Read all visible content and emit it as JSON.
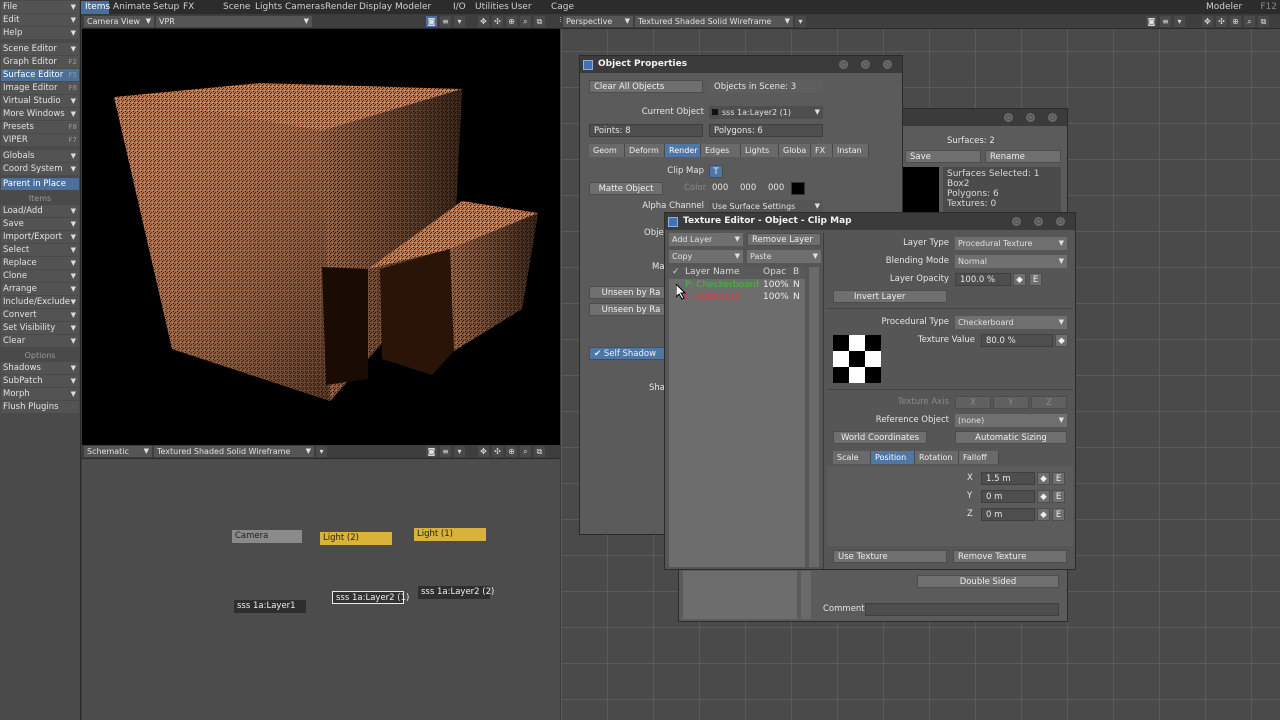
{
  "menu_tabs": [
    "Items",
    "Animate",
    "Setup",
    "FX Tools",
    "Scene",
    "Lights",
    "Cameras",
    "Render",
    "Display",
    "Modeler Tools",
    "I/O",
    "Utilities",
    "User Tab",
    "Cage Deformer"
  ],
  "modeler_label": "Modeler",
  "modeler_key": "F12",
  "left_menu": {
    "top": [
      {
        "label": "File"
      },
      {
        "label": "Edit"
      },
      {
        "label": "Help"
      }
    ],
    "editors": [
      {
        "label": "Scene Editor",
        "key": ""
      },
      {
        "label": "Graph Editor",
        "key": "F2"
      },
      {
        "label": "Surface Editor",
        "key": "F5"
      },
      {
        "label": "Image Editor",
        "key": "F6"
      },
      {
        "label": "Virtual Studio",
        "key": ""
      },
      {
        "label": "More Windows",
        "key": ""
      },
      {
        "label": "Presets",
        "key": "F8"
      },
      {
        "label": "VIPER",
        "key": "F7"
      }
    ],
    "globals": [
      {
        "label": "Globals"
      },
      {
        "label": "Coord System"
      }
    ],
    "parent_in_place": "Parent in Place",
    "items_header": "Items",
    "items": [
      {
        "label": "Load/Add"
      },
      {
        "label": "Save"
      },
      {
        "label": "Import/Export"
      },
      {
        "label": "Select"
      },
      {
        "label": "Replace"
      },
      {
        "label": "Clone"
      },
      {
        "label": "Arrange"
      },
      {
        "label": "Include/Exclude"
      },
      {
        "label": "Convert"
      },
      {
        "label": "Set Visibility"
      },
      {
        "label": "Clear"
      }
    ],
    "options_header": "Options",
    "options": [
      {
        "label": "Shadows"
      },
      {
        "label": "SubPatch"
      },
      {
        "label": "Morph"
      },
      {
        "label": "Flush Plugins"
      }
    ]
  },
  "vp_camera": {
    "view": "Camera View",
    "mode": "VPR"
  },
  "vp_schematic": {
    "view": "Schematic",
    "mode": "Textured Shaded Solid Wireframe"
  },
  "schematic_nodes": [
    "Camera",
    "Light (2)",
    "Light (1)",
    "sss 1a:Layer1",
    "sss 1a:Layer2 (1)",
    "sss 1a:Layer2 (2)"
  ],
  "vp_perspective": {
    "view": "Perspective",
    "mode": "Textured Shaded Solid Wireframe"
  },
  "object_properties": {
    "title": "Object Properties",
    "clear_all": "Clear All Objects",
    "objects_in_scene": "Objects in Scene: 3",
    "current_object_label": "Current Object",
    "current_object": "sss 1a:Layer2 (1)",
    "points": "Points: 8",
    "polygons": "Polygons: 6",
    "tabs": [
      "Geom",
      "Deform",
      "Render",
      "Edges",
      "Lights",
      "Globa",
      "FX",
      "Instan"
    ],
    "active_tab": "Render",
    "clip_map_label": "Clip Map",
    "clip_map_btn": "T",
    "matte_object": "Matte Object",
    "color_label": "Color",
    "color_vals": [
      "000",
      "000",
      "000"
    ],
    "alpha_label": "Alpha Channel",
    "alpha_value": "Use Surface Settings",
    "obj_partial": "Objec",
    "ma_partial": "Ma",
    "unseen1": "Unseen by Ra",
    "unseen2": "Unseen by Ra",
    "self_shadow": "Self Shadow",
    "sha_partial": "Shad"
  },
  "surface_editor": {
    "surfaces": "Surfaces: 2",
    "save": "Save",
    "rename": "Rename",
    "info": [
      "Surfaces Selected: 1",
      "Box2",
      "Polygons: 6",
      "Textures: 0"
    ],
    "double_sided": "Double Sided",
    "comment": "Comment"
  },
  "texture_editor": {
    "title": "Texture Editor - Object - Clip Map",
    "add_layer": "Add Layer",
    "remove_layer": "Remove Layer",
    "copy": "Copy",
    "paste": "Paste",
    "col_check": "✓",
    "col_name": "Layer Name",
    "col_opac": "Opac",
    "col_b": "B",
    "layers": [
      {
        "name": "P: Checkerboard",
        "opac": "100%",
        "b": "N",
        "color": "#3fbf3f"
      },
      {
        "name": "I: Raster.psd",
        "opac": "100%",
        "b": "N",
        "color": "#d04040"
      }
    ],
    "layer_type_label": "Layer Type",
    "layer_type": "Procedural Texture",
    "blending_label": "Blending Mode",
    "blending": "Normal",
    "opacity_label": "Layer Opacity",
    "opacity": "100.0 %",
    "env_e": "E",
    "invert_layer": "Invert Layer",
    "proc_type_label": "Procedural Type",
    "proc_type": "Checkerboard",
    "tex_value_label": "Texture Value",
    "tex_value": "80.0 %",
    "texture_axis_label": "Texture Axis",
    "axis_x": "X",
    "axis_y": "Y",
    "axis_z": "Z",
    "ref_object_label": "Reference Object",
    "ref_object": "(none)",
    "world_coords": "World Coordinates",
    "auto_sizing": "Automatic Sizing",
    "sub_tabs": [
      "Scale",
      "Position",
      "Rotation",
      "Falloff"
    ],
    "active_sub": "Position",
    "x_label": "X",
    "x_val": "1.5 m",
    "y_label": "Y",
    "y_val": "0 m",
    "z_label": "Z",
    "z_val": "0 m",
    "use_texture": "Use Texture",
    "remove_texture": "Remove Texture"
  }
}
